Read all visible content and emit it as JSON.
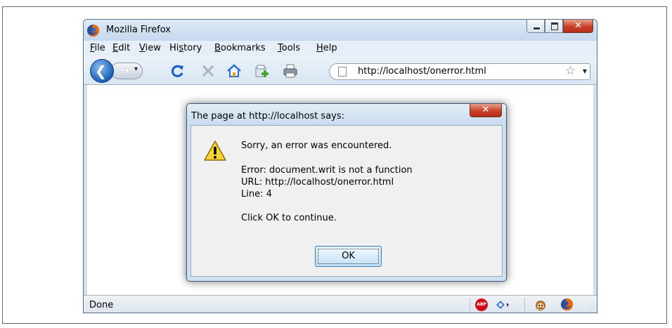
{
  "window": {
    "title": "Mozilla Firefox"
  },
  "menubar": {
    "items": [
      {
        "pre": "",
        "key": "F",
        "post": "ile"
      },
      {
        "pre": "",
        "key": "E",
        "post": "dit"
      },
      {
        "pre": "",
        "key": "V",
        "post": "iew"
      },
      {
        "pre": "Hi",
        "key": "s",
        "post": "tory"
      },
      {
        "pre": "",
        "key": "B",
        "post": "ookmarks"
      },
      {
        "pre": "",
        "key": "T",
        "post": "ools"
      },
      {
        "pre": "",
        "key": "H",
        "post": "elp"
      }
    ]
  },
  "toolbar": {
    "url": "http://localhost/onerror.html",
    "icons": [
      "back-icon",
      "forward-icon",
      "reload-icon",
      "stop-icon",
      "home-icon",
      "new-tab-icon",
      "print-icon",
      "bookmark-star-icon"
    ]
  },
  "dialog": {
    "title": "The page at http://localhost says:",
    "lines": [
      "Sorry, an error was encountered.",
      "Error: document.writ is not a function",
      "URL: http://localhost/onerror.html",
      "Line: 4",
      "Click OK to continue."
    ],
    "ok_label": "OK"
  },
  "statusbar": {
    "text": "Done",
    "abp_label": "ABP"
  },
  "colors": {
    "window_frame": "#cfe0f1",
    "close_red": "#c9402a",
    "ok_border": "#3c7fb1"
  }
}
